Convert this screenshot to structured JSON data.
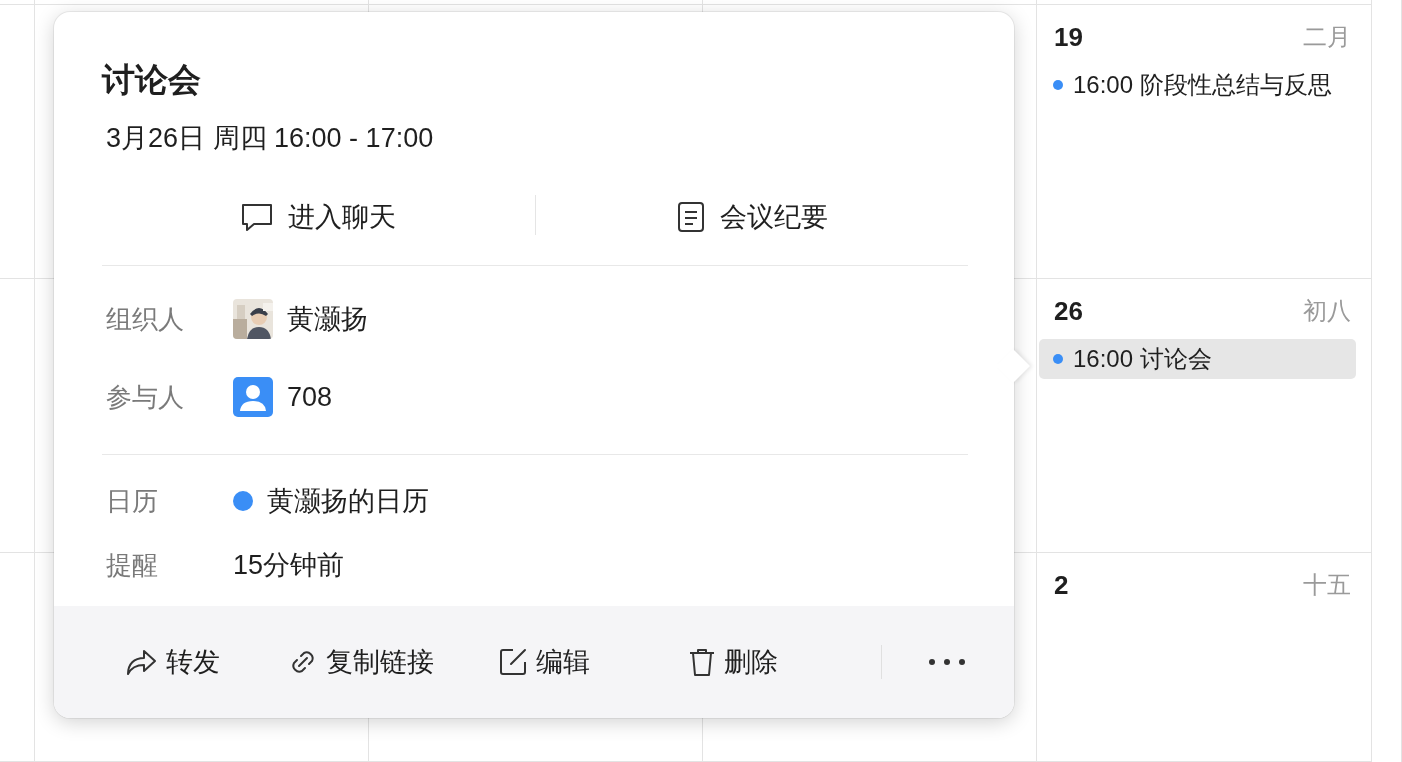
{
  "calendar": {
    "cells": [
      {
        "day": "19",
        "lunar": "二月",
        "events": [
          {
            "time": "16:00",
            "title": "阶段性总结与反思",
            "color": "#3a8ef6",
            "selected": false
          }
        ]
      },
      {
        "day": "26",
        "lunar": "初八",
        "events": [
          {
            "time": "16:00",
            "title": "讨论会",
            "color": "#3a8ef6",
            "selected": true
          }
        ]
      },
      {
        "day": "2",
        "lunar": "十五"
      }
    ]
  },
  "popup": {
    "title": "讨论会",
    "datetime": "3月26日 周四 16:00 - 17:00",
    "actions": [
      {
        "kind": "chat",
        "label": "进入聊天"
      },
      {
        "kind": "notes",
        "label": "会议纪要"
      }
    ],
    "sections": [
      [
        {
          "kind": "person",
          "label": "组织人",
          "value": "黄灏扬"
        },
        {
          "kind": "group",
          "label": "参与人",
          "value": "708"
        }
      ],
      [
        {
          "kind": "calendar",
          "label": "日历",
          "value": "黄灏扬的日历",
          "color": "#3a8ef6"
        },
        {
          "kind": "text",
          "label": "提醒",
          "value": "15分钟前"
        }
      ]
    ],
    "footer": [
      {
        "kind": "forward",
        "label": "转发"
      },
      {
        "kind": "link",
        "label": "复制链接"
      },
      {
        "kind": "edit",
        "label": "编辑"
      },
      {
        "kind": "delete",
        "label": "删除"
      },
      {
        "kind": "more"
      }
    ]
  }
}
